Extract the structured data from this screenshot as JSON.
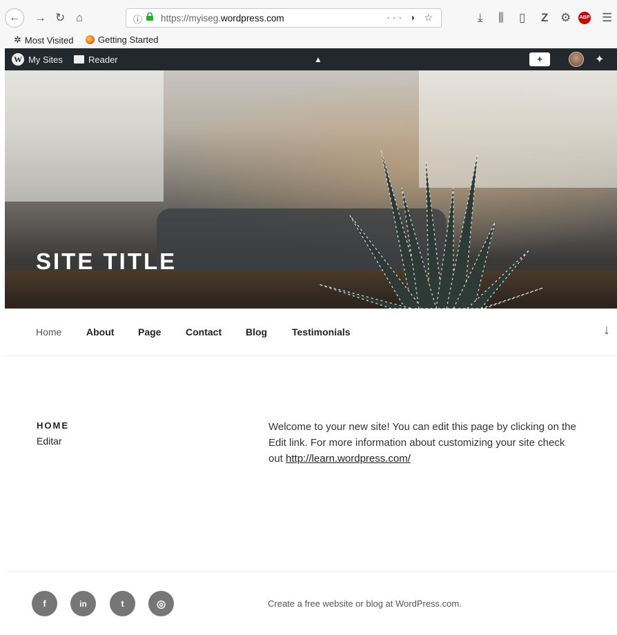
{
  "browser": {
    "url_prefix": "https://myiseg.",
    "url_domain": "wordpress.com",
    "page_actions": "···",
    "bookmarks": [
      "Most Visited",
      "Getting Started"
    ],
    "abp_label": "ABP"
  },
  "admin_bar": {
    "my_sites": "My Sites",
    "reader": "Reader"
  },
  "site": {
    "title": "SITE TITLE"
  },
  "nav": {
    "items": [
      "Home",
      "About",
      "Page",
      "Contact",
      "Blog",
      "Testimonials"
    ]
  },
  "page": {
    "title": "HOME",
    "edit_link": "Editar",
    "body_text": "Welcome to your new site! You can edit this page by clicking on the Edit link. For more information about customizing your site check out ",
    "body_link": "http://learn.wordpress.com/"
  },
  "footer": {
    "social": [
      {
        "name": "facebook",
        "glyph": "f"
      },
      {
        "name": "linkedin",
        "glyph": "in"
      },
      {
        "name": "twitter",
        "glyph": "t"
      },
      {
        "name": "instagram",
        "glyph": "◎"
      }
    ],
    "credit": "Create a free website or blog at WordPress.com."
  },
  "colors": {
    "admin_bar": "#23282d",
    "social_bg": "#767676",
    "lock": "#2ea82e"
  }
}
